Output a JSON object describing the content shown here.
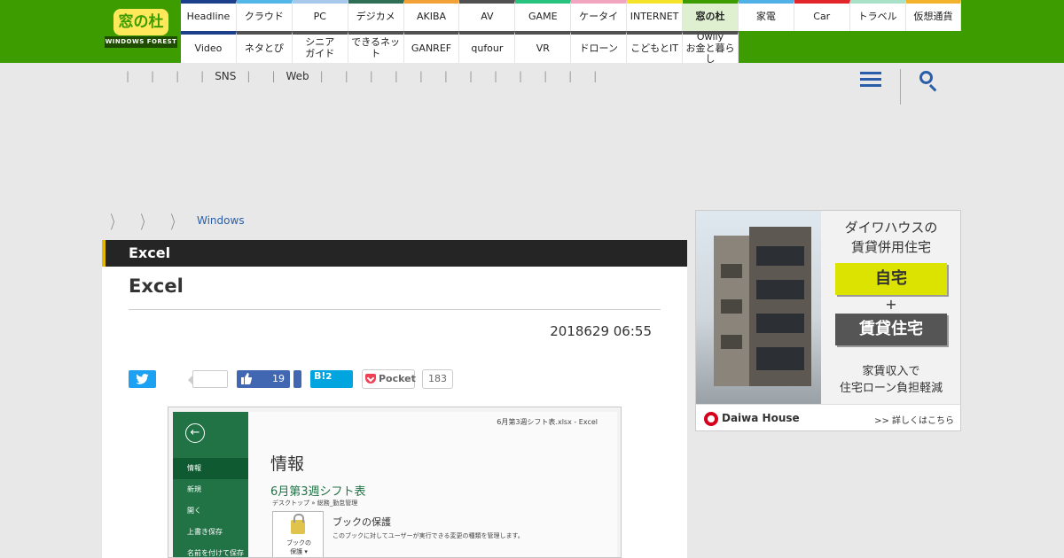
{
  "logo": {
    "main": "窓の杜",
    "sub": "WINDOWS FOREST"
  },
  "nav": {
    "row1": [
      {
        "label": "Headline",
        "color": "#1b3f8b"
      },
      {
        "label": "クラウド",
        "color": "#52b6e8"
      },
      {
        "label": "PC",
        "color": "#a5c8eb"
      },
      {
        "label": "デジカメ",
        "color": "#2d6e55"
      },
      {
        "label": "AKIBA",
        "color": "#f3a136"
      },
      {
        "label": "AV",
        "color": "#505050"
      },
      {
        "label": "GAME",
        "color": "#27c27d"
      },
      {
        "label": "ケータイ",
        "color": "#f2a5bf"
      },
      {
        "label": "INTERNET",
        "color": "#f5e32a"
      },
      {
        "label": "窓の杜",
        "color": "#3c9c00",
        "active": true
      },
      {
        "label": "家電",
        "color": "#4fb1e5"
      },
      {
        "label": "Car",
        "color": "#e3242b"
      },
      {
        "label": "トラベル",
        "color": "#a8e0c8"
      },
      {
        "label": "仮想通貨",
        "color": "#f3b22b"
      }
    ],
    "row2": [
      {
        "label": "Video",
        "color": "#1b3f8b"
      },
      {
        "label": "ネタとぴ",
        "color": "#505050"
      },
      {
        "label": "シニア\nガイド",
        "color": "#505050"
      },
      {
        "label": "できるネット",
        "color": "#505050"
      },
      {
        "label": "GANREF",
        "color": "#505050"
      },
      {
        "label": "qufour",
        "color": "#505050"
      },
      {
        "label": "VR",
        "color": "#505050"
      },
      {
        "label": "ドローン",
        "color": "#505050"
      },
      {
        "label": "こどもとIT",
        "color": "#505050"
      },
      {
        "label": "Owlly\nお金と暮らし",
        "color": "#505050"
      }
    ]
  },
  "subnav": [
    "",
    "",
    "",
    "SNS",
    "",
    "Web",
    "",
    "",
    "",
    "",
    "",
    "",
    "",
    "",
    "",
    "",
    "",
    ""
  ],
  "breadcrumb": {
    "link": "Windows"
  },
  "article": {
    "section": "Excel",
    "title": "Excel",
    "date": "2018629 06:55"
  },
  "share": {
    "fb_count": "19",
    "hatena_label": "B!",
    "hatena_count": "2",
    "pocket_label": "Pocket",
    "pocket_count": "183"
  },
  "screenshot": {
    "back_glyph": "←",
    "menu": [
      "情報",
      "新規",
      "開く",
      "上書き保存",
      "名前を付けて保存"
    ],
    "file_title": "6月第3週シフト表.xlsx  -  Excel",
    "heading": "情報",
    "doc_name": "6月第3週シフト表",
    "path": "デスクトップ » 総務_勤怠管理",
    "tile_label": "ブックの\n保護 ▾",
    "section_title": "ブックの保護",
    "section_desc": "このブックに対してユーザーが実行できる変更の種類を管理します。"
  },
  "ad": {
    "headline": "ダイワハウスの\n賃貸併用住宅",
    "box1": "自宅",
    "plus": "+",
    "box2": "賃貸住宅",
    "tagline": "家賃収入で\n住宅ローン負担軽減",
    "brand": "Daiwa House",
    "cta": ">> 詳しくはこちら"
  }
}
